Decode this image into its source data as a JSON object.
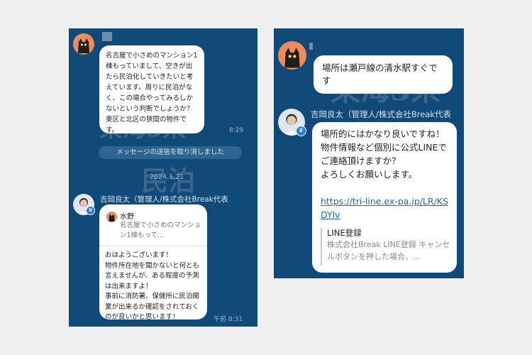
{
  "left_panel": {
    "watermark_1": "東海3県",
    "watermark_2": "民泊",
    "message_1": "名古屋で小さめのマンション1棟もっていまして、空きが出たら民泊化していきたいと考えています。周りに民泊がなく、この場合やってみるしかないという判断でしょうか？東区と北区の狭間の物件です。",
    "time_1": "8:29",
    "unsent_notice": "メッセージの送信を取り消しました",
    "date_divider": "2024.1.21",
    "sender_name": "吉岡良太（管理人/株式会社Break代表",
    "reply_quote_name": "水野",
    "reply_quote_text": "名古屋で小さめのマンション1棟もって...",
    "message_2": "おはようございます！\n物件所在地を聞かないと何とも言えませんが、ある程度の予測は出来ますよ！\n事前に消防署、保健所に民泊開業が出来るか確認をされておくのが良いかと思います！",
    "time_2": "午前 8:31"
  },
  "right_panel": {
    "watermark_1": "東海3県",
    "message_1": "場所は瀬戸線の清水駅すぐです",
    "sender_name": "吉岡良太（管理人/株式会社Break代表",
    "message_2_text": "場所的にはかなり良いですね！\n物件情報など個別に公式LINEでご連絡頂けますか？\nよろしくお願いします。",
    "message_2_link": "https://tri-line.ex-pa.jp/LR/KSDYlv",
    "preview_title": "LINE登録",
    "preview_desc": "株式会社Break LINE登録 キャンセルボタンを押した場合、..."
  },
  "icons": [
    "cat-icon",
    "crown-icon"
  ],
  "colors": {
    "background": "#efefef",
    "chat_background": "#0f4a78",
    "bubble": "#ffffff",
    "link": "#1d63c9",
    "badge": "#2f7bd9",
    "cat_avatar": "#f08a5d"
  }
}
